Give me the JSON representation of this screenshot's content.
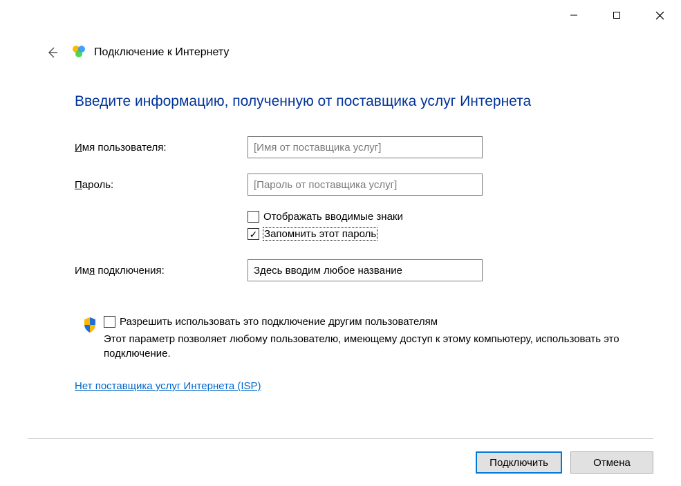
{
  "window": {
    "title": "Подключение к Интернету"
  },
  "heading": "Введите информацию, полученную от поставщика услуг Интернета",
  "form": {
    "username": {
      "label_pre": "И",
      "label_post": "мя пользователя:",
      "placeholder": "[Имя от поставщика услуг]"
    },
    "password": {
      "label_pre": "П",
      "label_post": "ароль:",
      "placeholder": "[Пароль от поставщика услуг]"
    },
    "show_chars": {
      "label_pre": "Отобра",
      "label_ul": "ж",
      "label_post": "ать вводимые знаки"
    },
    "remember": {
      "label_pre": "З",
      "label_post": "апомнить этот пароль"
    },
    "connection_name": {
      "label_pre": "Им",
      "label_ul": "я",
      "label_post": " подключения:",
      "value": "Здесь вводим любое название"
    }
  },
  "share": {
    "label_pre": "Р",
    "label_post": "азрешить использовать это подключение другим пользователям",
    "description": "Этот параметр позволяет любому пользователю, имеющему доступ к этому компьютеру, использовать это подключение."
  },
  "isp_link": "Нет поставщика услуг Интернета (ISP)",
  "buttons": {
    "connect_pre": "Подкл",
    "connect_ul": "ю",
    "connect_post": "чить",
    "cancel": "Отмена"
  }
}
